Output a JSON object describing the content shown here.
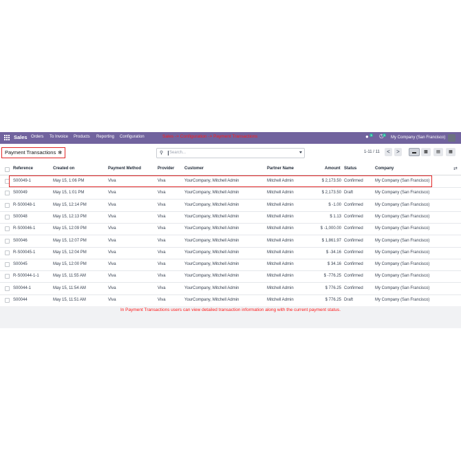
{
  "navbar": {
    "brand": "Sales",
    "menu": [
      "Orders",
      "To Invoice",
      "Products",
      "Reporting",
      "Configuration"
    ],
    "annotation": "Sales -> Configuration -> Payment Transactions",
    "chat_badge": "3",
    "activity_badge": "3",
    "company": "My Company (San Francisco)"
  },
  "control": {
    "breadcrumb": "Payment Transactions",
    "search_placeholder": "Search...",
    "pager": "1-11 / 11",
    "prev": "<",
    "next": ">"
  },
  "table": {
    "headers": [
      "Reference",
      "Created on",
      "Payment Method",
      "Provider",
      "Customer",
      "Partner Name",
      "Amount",
      "Status",
      "Company"
    ],
    "rows": [
      [
        "S00049-1",
        "May 15, 1:06 PM",
        "Viva",
        "Viva",
        "YourCompany, Mitchell Admin",
        "Mitchell Admin",
        "$ 2,173.50",
        "Confirmed",
        "My Company (San Francisco)"
      ],
      [
        "S00049",
        "May 15, 1:01 PM",
        "Viva",
        "Viva",
        "YourCompany, Mitchell Admin",
        "Mitchell Admin",
        "$ 2,173.50",
        "Draft",
        "My Company (San Francisco)"
      ],
      [
        "R-S00048-1",
        "May 15, 12:14 PM",
        "Viva",
        "Viva",
        "YourCompany, Mitchell Admin",
        "Mitchell Admin",
        "$ -1.00",
        "Confirmed",
        "My Company (San Francisco)"
      ],
      [
        "S00048",
        "May 15, 12:13 PM",
        "Viva",
        "Viva",
        "YourCompany, Mitchell Admin",
        "Mitchell Admin",
        "$ 1.13",
        "Confirmed",
        "My Company (San Francisco)"
      ],
      [
        "R-S00046-1",
        "May 15, 12:09 PM",
        "Viva",
        "Viva",
        "YourCompany, Mitchell Admin",
        "Mitchell Admin",
        "$ -1,000.00",
        "Confirmed",
        "My Company (San Francisco)"
      ],
      [
        "S00046",
        "May 15, 12:07 PM",
        "Viva",
        "Viva",
        "YourCompany, Mitchell Admin",
        "Mitchell Admin",
        "$ 1,861.97",
        "Confirmed",
        "My Company (San Francisco)"
      ],
      [
        "R-S00045-1",
        "May 15, 12:04 PM",
        "Viva",
        "Viva",
        "YourCompany, Mitchell Admin",
        "Mitchell Admin",
        "$ -34.16",
        "Confirmed",
        "My Company (San Francisco)"
      ],
      [
        "S00045",
        "May 15, 12:00 PM",
        "Viva",
        "Viva",
        "YourCompany, Mitchell Admin",
        "Mitchell Admin",
        "$ 34.16",
        "Confirmed",
        "My Company (San Francisco)"
      ],
      [
        "R-S00044-1-1",
        "May 15, 11:55 AM",
        "Viva",
        "Viva",
        "YourCompany, Mitchell Admin",
        "Mitchell Admin",
        "$ -776.25",
        "Confirmed",
        "My Company (San Francisco)"
      ],
      [
        "S00044-1",
        "May 15, 11:54 AM",
        "Viva",
        "Viva",
        "YourCompany, Mitchell Admin",
        "Mitchell Admin",
        "$ 776.25",
        "Confirmed",
        "My Company (San Francisco)"
      ],
      [
        "S00044",
        "May 15, 11:51 AM",
        "Viva",
        "Viva",
        "YourCompany, Mitchell Admin",
        "Mitchell Admin",
        "$ 776.25",
        "Draft",
        "My Company (San Francisco)"
      ]
    ]
  },
  "caption": "In Payment Transactions users can view detailed transaction information along with the current payment status.",
  "colors": {
    "navbar": "#71639e",
    "highlight": "#e02424",
    "annotation": "#ff1a1a"
  },
  "icons": [
    "apps-grid-icon",
    "chat-icon",
    "activity-icon",
    "gear-icon",
    "search-icon",
    "dropdown-caret-icon",
    "list-view-icon",
    "kanban-view-icon",
    "graph-view-icon",
    "pivot-view-icon",
    "optional-columns-icon"
  ]
}
